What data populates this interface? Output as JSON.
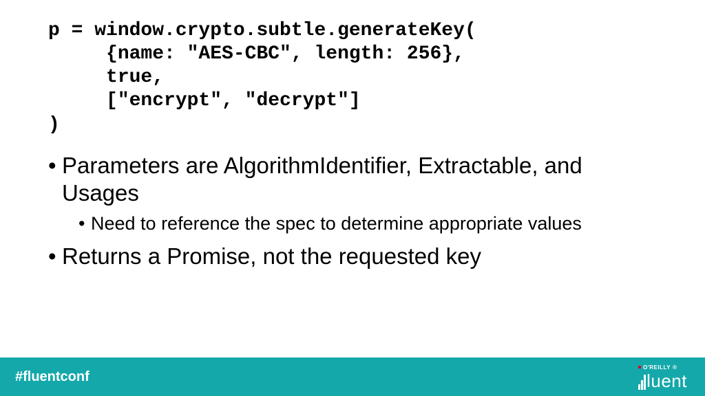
{
  "code": "p = window.crypto.subtle.generateKey(\n     {name: \"AES-CBC\", length: 256},\n     true,\n     [\"encrypt\", \"decrypt\"]\n)",
  "bullets": {
    "b1": "Parameters are AlgorithmIdentifier, Extractable, and Usages",
    "b1_sub1": "Need to reference the spec to determine appropriate values",
    "b2": "Returns a Promise, not the requested key"
  },
  "footer": {
    "hashtag": "#fluentconf",
    "brand_small": "O'REILLY",
    "brand_reg": "®",
    "brand": "luent"
  }
}
